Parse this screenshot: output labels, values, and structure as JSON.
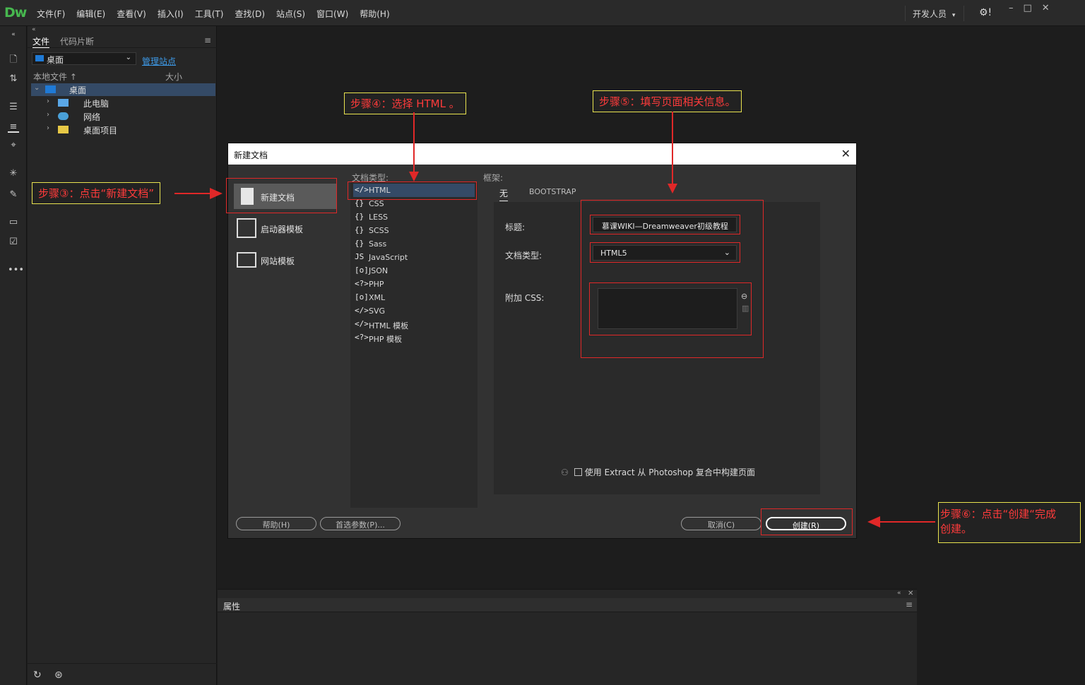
{
  "app": {
    "logo": "Dw"
  },
  "menu": [
    "文件(F)",
    "编辑(E)",
    "查看(V)",
    "插入(I)",
    "工具(T)",
    "查找(D)",
    "站点(S)",
    "窗口(W)",
    "帮助(H)"
  ],
  "workspace": {
    "label": "开发人员"
  },
  "files_panel": {
    "tab_files": "文件",
    "tab_snippets": "代码片断",
    "site_select": "桌面",
    "manage_site": "管理站点",
    "col_local": "本地文件",
    "col_size": "大小",
    "tree": [
      {
        "label": "桌面",
        "expanded": true
      },
      {
        "label": "此电脑"
      },
      {
        "label": "网络"
      },
      {
        "label": "桌面项目"
      }
    ]
  },
  "properties_panel": {
    "tab": "属性"
  },
  "dialog": {
    "title": "新建文档",
    "categories": [
      "新建文档",
      "启动器模板",
      "网站模板"
    ],
    "doctype_header": "文档类型:",
    "doctypes": [
      {
        "icon": "</>",
        "label": "HTML"
      },
      {
        "icon": "{}",
        "label": "CSS"
      },
      {
        "icon": "{}",
        "label": "LESS"
      },
      {
        "icon": "{}",
        "label": "SCSS"
      },
      {
        "icon": "{}",
        "label": "Sass"
      },
      {
        "icon": "JS",
        "label": "JavaScript"
      },
      {
        "icon": "[o]",
        "label": "JSON"
      },
      {
        "icon": "<?>",
        "label": "PHP"
      },
      {
        "icon": "[o]",
        "label": "XML"
      },
      {
        "icon": "</>",
        "label": "SVG"
      },
      {
        "icon": "</>",
        "label": "HTML 模板"
      },
      {
        "icon": "<?>",
        "label": "PHP 模板"
      }
    ],
    "framework_header": "框架:",
    "framework_tabs": [
      "无",
      "BOOTSTRAP"
    ],
    "title_label": "标题:",
    "title_value": "慕课WIKI—Dreamweaver初级教程",
    "doc_type_label": "文档类型:",
    "doc_type_value": "HTML5",
    "css_label": "附加 CSS:",
    "extract_label": "使用 Extract 从 Photoshop 复合中构建页面",
    "buttons": {
      "help": "帮助(H)",
      "prefs": "首选参数(P)...",
      "cancel": "取消(C)",
      "create": "创建(R)"
    }
  },
  "annotations": {
    "step3": "步骤③：点击“新建文档”",
    "step4": "步骤④：选择 HTML 。",
    "step5": "步骤⑤：填写页面相关信息。",
    "step6_line1": "步骤⑥：点击“创建“完成",
    "step6_line2": "创建。"
  },
  "colors": {
    "accent_red": "#e02828",
    "note_border": "#e9e34f",
    "selection": "#344a66",
    "logo": "#47b84f"
  }
}
